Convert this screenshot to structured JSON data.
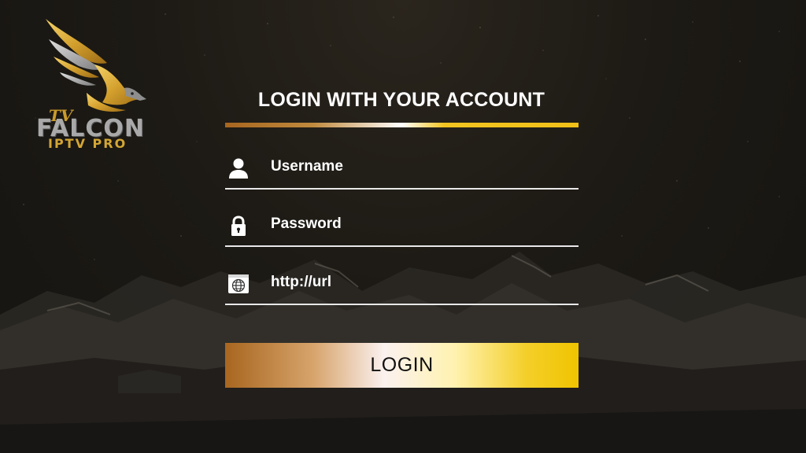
{
  "logo": {
    "tv_text": "TV",
    "title": "FALCON",
    "subtitle": "IPTV PRO"
  },
  "form": {
    "title": "LOGIN WITH YOUR ACCOUNT",
    "username": {
      "placeholder": "Username",
      "icon": "user-icon"
    },
    "password": {
      "placeholder": "Password",
      "icon": "lock-icon"
    },
    "url": {
      "placeholder": "http://url",
      "icon": "globe-icon"
    },
    "login_label": "LOGIN"
  },
  "colors": {
    "gold": "#f0c400",
    "bronze": "#a8661f",
    "background": "#1d1a15",
    "text": "#ffffff"
  }
}
